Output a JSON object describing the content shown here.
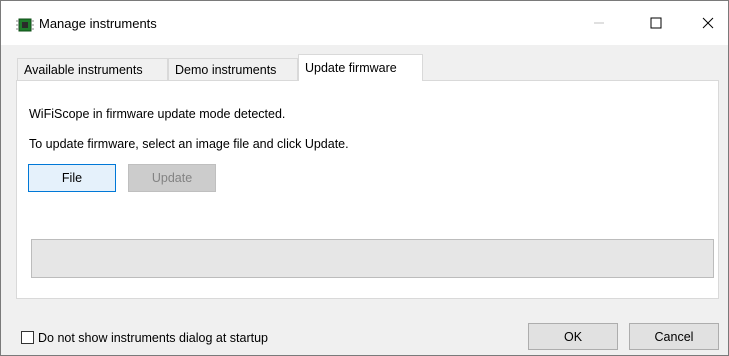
{
  "window": {
    "title": "Manage instruments",
    "icon": "circuit-board-icon"
  },
  "tabs": [
    {
      "label": "Available instruments",
      "active": false
    },
    {
      "label": "Demo instruments",
      "active": false
    },
    {
      "label": "Update firmware",
      "active": true
    }
  ],
  "update_panel": {
    "detected_message": "WiFiScope in firmware update mode detected.",
    "instruction_message": "To update firmware, select an image file and click Update.",
    "file_button": "File",
    "update_button": "Update",
    "update_enabled": false,
    "progress": 0
  },
  "footer": {
    "startup_checkbox_label": "Do not show instruments dialog at startup",
    "startup_checkbox_checked": false,
    "ok_button": "OK",
    "cancel_button": "Cancel"
  },
  "colors": {
    "accent": "#0078d7",
    "focused_button_bg": "#e5f1fb",
    "disabled_button_bg": "#cccccc"
  }
}
